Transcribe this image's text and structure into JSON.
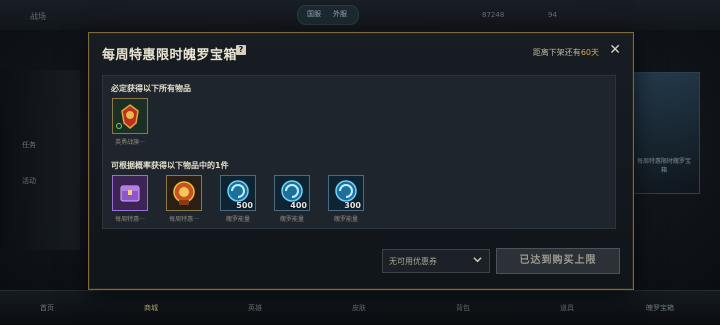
{
  "background": {
    "topbar_left": "战场",
    "toggle_labels": [
      "国服",
      "外服"
    ],
    "topbar_right": [
      "87248",
      "94"
    ],
    "side_labels": [
      "任务",
      "活动"
    ],
    "card_text": "每周特惠限时魄罗宝箱",
    "bottom_tabs": [
      "首页",
      "商城",
      "英雄",
      "皮肤",
      "背包",
      "道具",
      "魄罗宝箱"
    ],
    "active_bottom_tab_index": 1
  },
  "modal": {
    "title": "每周特惠限时魄罗宝箱",
    "help_glyph": "?",
    "countdown_prefix": "距离下架还有",
    "countdown_days": "60天",
    "close_glyph": "✕",
    "guaranteed_label": "必定获得以下所有物品",
    "guaranteed_items": [
      {
        "name": "英勇战旗···",
        "icon": "banner-emblem-icon",
        "quantity": ""
      }
    ],
    "random_label": "可根据概率获得以下物品中的1件",
    "random_items": [
      {
        "name": "每周特惠···",
        "icon": "purple-chest-icon",
        "quantity": ""
      },
      {
        "name": "每周特惠···",
        "icon": "orange-chest-icon",
        "quantity": ""
      },
      {
        "name": "魄罗能量",
        "icon": "poro-energy-icon",
        "quantity": "500"
      },
      {
        "name": "魄罗能量",
        "icon": "poro-energy-icon",
        "quantity": "400"
      },
      {
        "name": "魄罗能量",
        "icon": "poro-energy-icon",
        "quantity": "300"
      }
    ],
    "coupon_select": "无可用优惠券",
    "buy_button": "已达到购买上限"
  },
  "colors": {
    "accent_gold": "#d8a84b",
    "frame_gold": "#7d6a3c",
    "disabled_button": "#2b3137"
  }
}
